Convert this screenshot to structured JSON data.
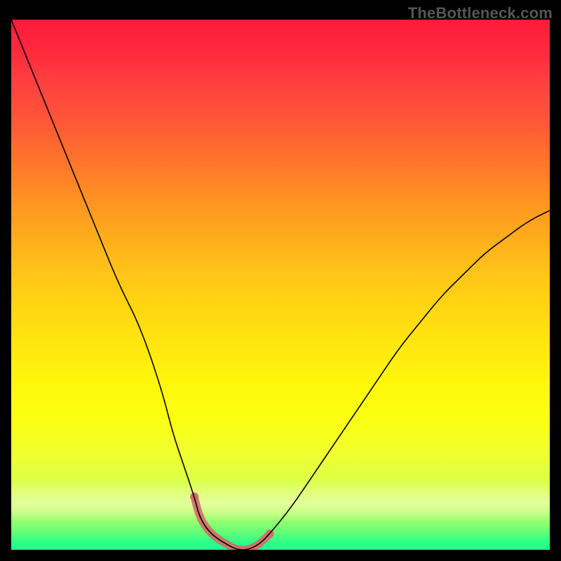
{
  "watermark": "TheBottleneck.com",
  "chart_data": {
    "type": "line",
    "title": "",
    "xlabel": "",
    "ylabel": "",
    "xlim": [
      0,
      100
    ],
    "ylim": [
      0,
      100
    ],
    "grid": false,
    "legend": false,
    "x": [
      0,
      4,
      8,
      12,
      16,
      20,
      24,
      28,
      30,
      32,
      34,
      35,
      37,
      40,
      42,
      44,
      46,
      48,
      52,
      56,
      60,
      64,
      68,
      72,
      76,
      80,
      84,
      88,
      92,
      96,
      100
    ],
    "values": [
      100,
      90,
      80,
      70,
      60,
      50,
      42,
      30,
      22,
      16,
      10,
      6,
      3,
      1,
      0,
      0,
      1,
      3,
      8,
      14,
      20,
      26,
      32,
      38,
      43,
      48,
      52,
      56,
      59,
      62,
      64
    ],
    "highlight_range_x": [
      34,
      48
    ],
    "accent_color": "#d46a6a",
    "line_color": "#000000"
  }
}
